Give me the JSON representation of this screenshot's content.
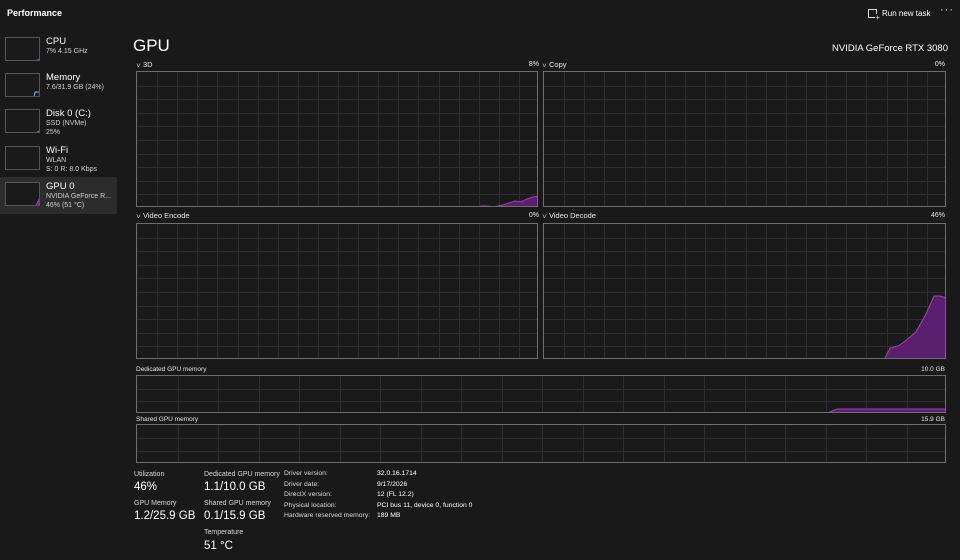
{
  "header": {
    "title": "Performance",
    "run_task_label": "Run new task",
    "more_label": "···"
  },
  "sidebar": {
    "items": [
      {
        "name": "CPU",
        "line1": "7% 4.15 GHz",
        "line2": "",
        "color": "#1e90ff",
        "active": false
      },
      {
        "name": "Memory",
        "line1": "7.6/31.9 GB (24%)",
        "line2": "",
        "color": "#8fb3e8",
        "active": false
      },
      {
        "name": "Disk 0 (C:)",
        "line1": "SSD (NVMe)",
        "line2": "25%",
        "color": "#4caf50",
        "active": false
      },
      {
        "name": "Wi-Fi",
        "line1": "WLAN",
        "line2": "S: 0 R: 8.0 Kbps",
        "color": "#c07a2c",
        "active": false
      },
      {
        "name": "GPU 0",
        "line1": "NVIDIA GeForce R...",
        "line2": "46% (51 °C)",
        "color": "#b040c0",
        "active": true
      }
    ]
  },
  "main": {
    "title": "GPU",
    "model": "NVIDIA GeForce RTX 3080",
    "engines": [
      {
        "label": "3D",
        "percent": "8%"
      },
      {
        "label": "Copy",
        "percent": "0%"
      },
      {
        "label": "Video Encode",
        "percent": "0%"
      },
      {
        "label": "Video Decode",
        "percent": "46%"
      }
    ],
    "dedicated": {
      "label": "Dedicated GPU memory",
      "max": "10.0 GB"
    },
    "shared": {
      "label": "Shared GPU memory",
      "max": "15.9 GB"
    },
    "graph_color": "#a040b8"
  },
  "stats": {
    "utilization": {
      "label": "Utilization",
      "value": "46%"
    },
    "dedicated_mem": {
      "label": "Dedicated GPU memory",
      "value": "1.1/10.0 GB"
    },
    "gpu_memory": {
      "label": "GPU Memory",
      "value": "1.2/25.9 GB"
    },
    "shared_mem": {
      "label": "Shared GPU memory",
      "value": "0.1/15.9 GB"
    },
    "temperature": {
      "label": "Temperature",
      "value": "51 °C"
    }
  },
  "info": [
    {
      "label": "Driver version:",
      "value": "32.0.16.1714"
    },
    {
      "label": "Driver date:",
      "value": "9/17/2026"
    },
    {
      "label": "DirectX version:",
      "value": "12 (FL 12.2)"
    },
    {
      "label": "Physical location:",
      "value": "PCI bus 11, device 0, function 0"
    },
    {
      "label": "Hardware reserved memory:",
      "value": "189 MB"
    }
  ]
}
